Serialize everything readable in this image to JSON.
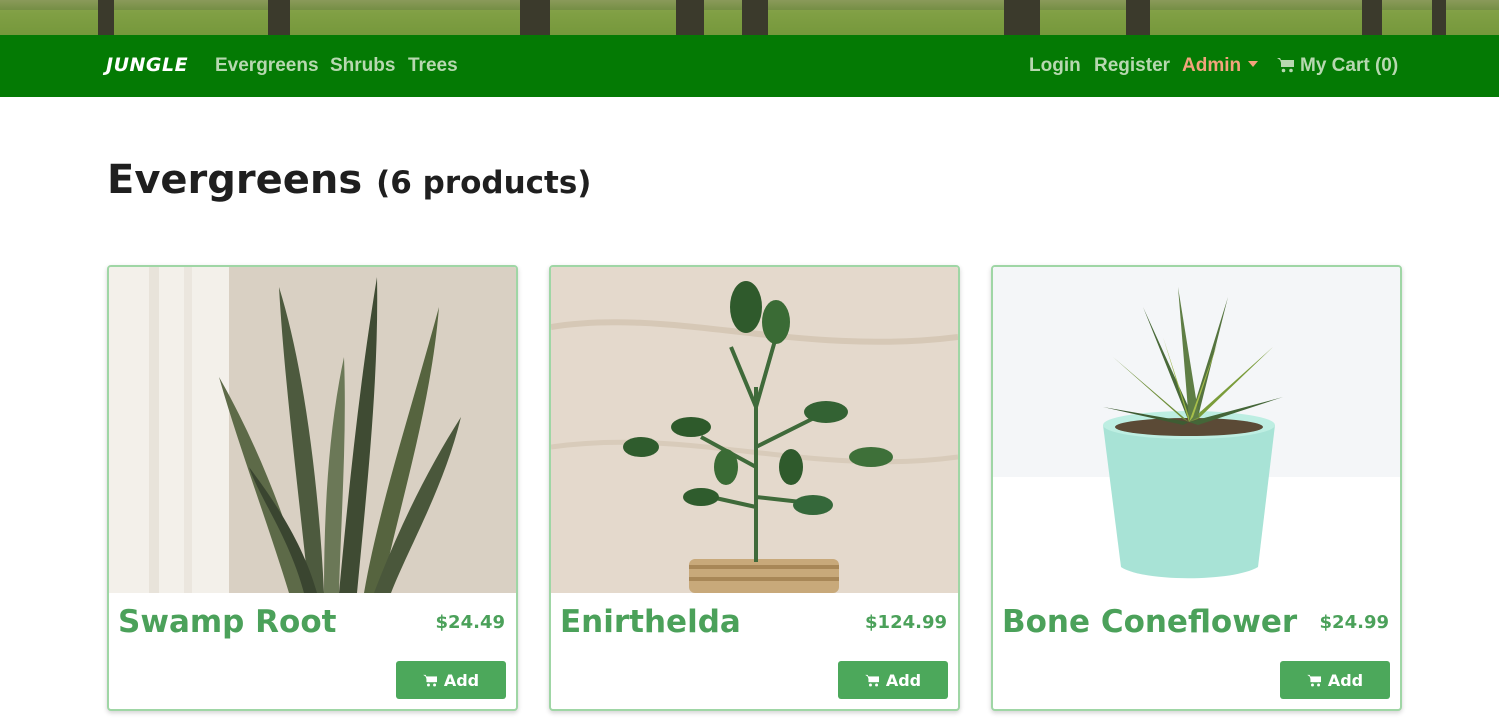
{
  "navbar": {
    "brand": "JUNGLE",
    "links": [
      "Evergreens",
      "Shrubs",
      "Trees"
    ],
    "login": "Login",
    "register": "Register",
    "admin": "Admin",
    "cart": "My Cart (0)"
  },
  "page": {
    "title": "Evergreens",
    "count": "(6 products)"
  },
  "products": [
    {
      "name": "Swamp Root",
      "price": "$24.49",
      "add_label": "Add",
      "image": "snake-plant-photo"
    },
    {
      "name": "Enirthelda",
      "price": "$124.99",
      "add_label": "Add",
      "image": "jade-plant-in-basket-photo"
    },
    {
      "name": "Bone Coneflower",
      "price": "$24.99",
      "add_label": "Add",
      "image": "succulent-in-mint-pot-photo"
    }
  ],
  "colors": {
    "navbar": "#047a04",
    "nav_link": "#b7d8b0",
    "admin": "#f3a37c",
    "accent": "#4ba15a",
    "card_border": "#9fd6a5"
  }
}
